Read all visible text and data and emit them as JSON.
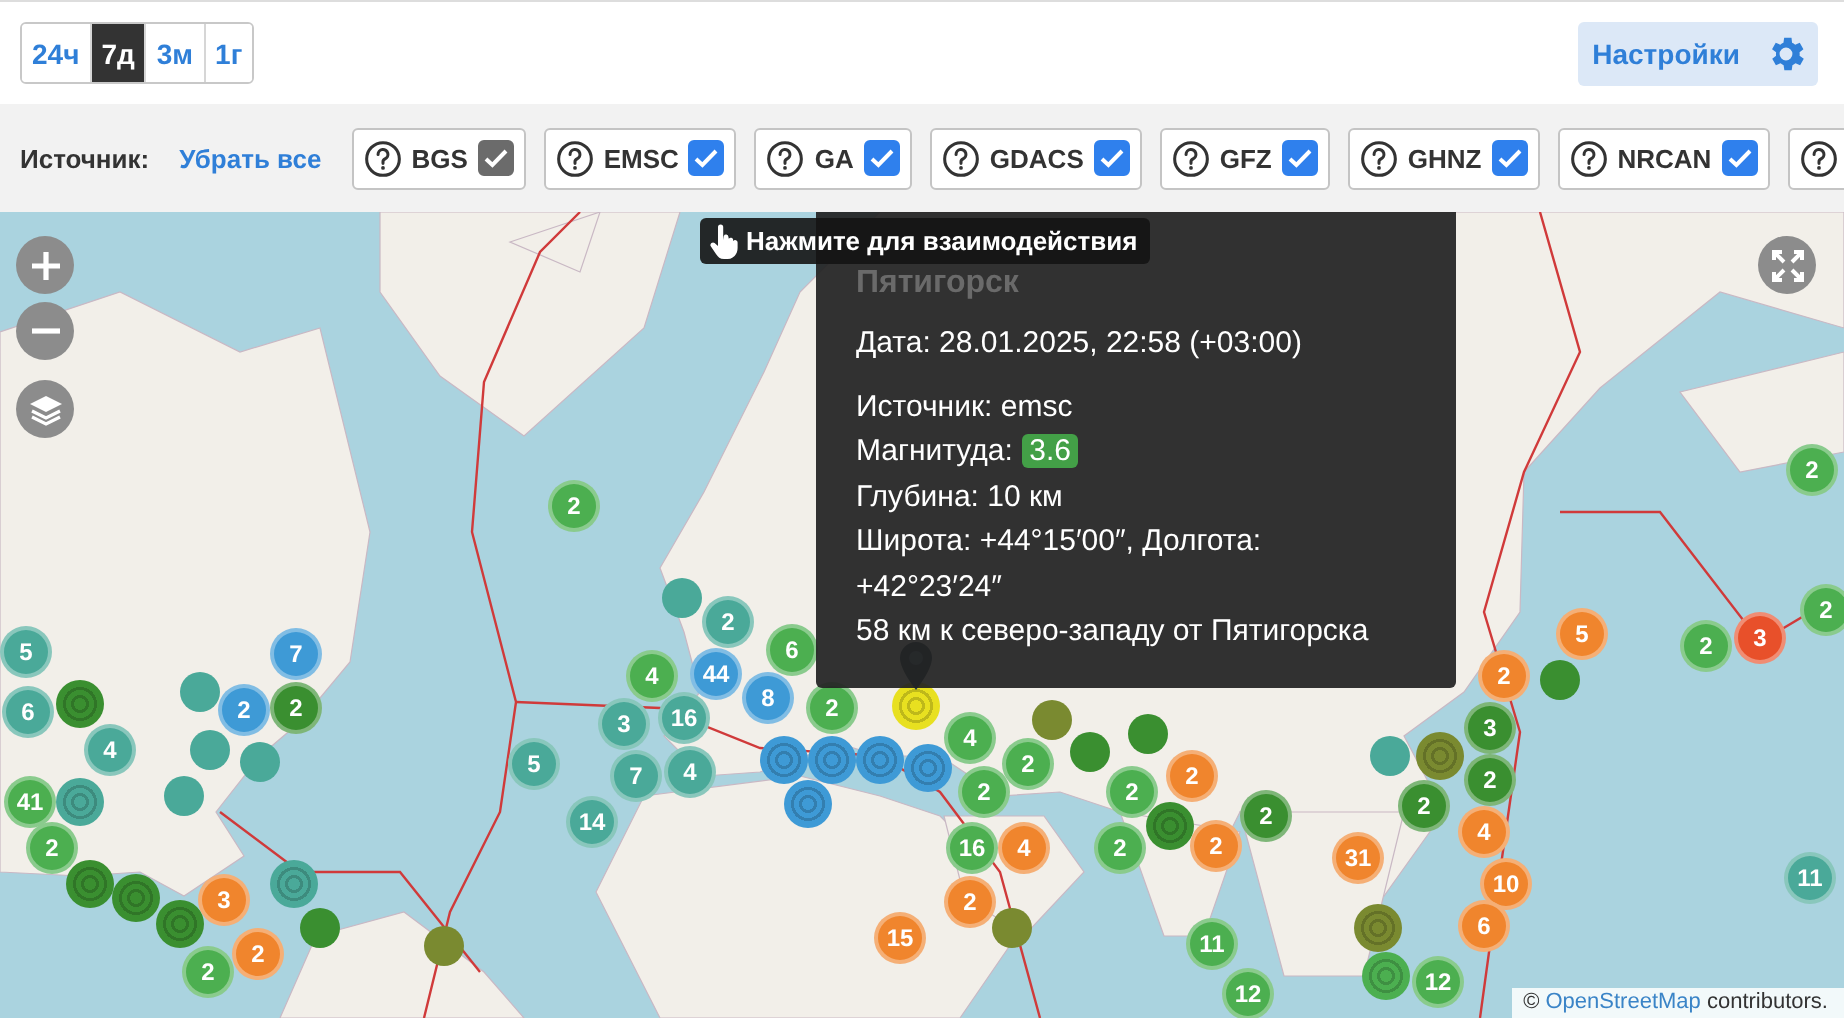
{
  "time_ranges": [
    {
      "label": "24ч",
      "selected": false
    },
    {
      "label": "7д",
      "selected": true
    },
    {
      "label": "3м",
      "selected": false
    },
    {
      "label": "1г",
      "selected": false
    }
  ],
  "settings_button": {
    "label": "Настройки"
  },
  "source_filter": {
    "label": "Источник:",
    "clear_link": "Убрать все",
    "sources": [
      {
        "label": "BGS",
        "checked": true,
        "disabled": true
      },
      {
        "label": "EMSC",
        "checked": true,
        "disabled": false
      },
      {
        "label": "GA",
        "checked": true,
        "disabled": false
      },
      {
        "label": "GDACS",
        "checked": true,
        "disabled": false
      },
      {
        "label": "GFZ",
        "checked": true,
        "disabled": false
      },
      {
        "label": "GHNZ",
        "checked": true,
        "disabled": false
      },
      {
        "label": "NRCAN",
        "checked": true,
        "disabled": false
      }
    ]
  },
  "map": {
    "markers": [
      {
        "kind": "cluster",
        "label": "2",
        "color": "#4caf50"
      },
      {
        "kind": "dot",
        "color": "#4aa999"
      },
      {
        "kind": "cluster",
        "label": "2",
        "color": "#4aa999"
      },
      {
        "kind": "cluster",
        "label": "6",
        "color": "#4caf50"
      },
      {
        "kind": "cluster",
        "label": "4",
        "color": "#4caf50"
      },
      {
        "kind": "cluster",
        "label": "16",
        "color": "#4aa999"
      },
      {
        "kind": "cluster",
        "label": "44",
        "color": "#3e9ad6"
      },
      {
        "kind": "cluster",
        "label": "8",
        "color": "#3e9ad6"
      },
      {
        "kind": "cluster",
        "label": "3",
        "color": "#4aa999"
      },
      {
        "kind": "cluster",
        "label": "7",
        "color": "#4aa999"
      },
      {
        "kind": "cluster",
        "label": "4",
        "color": "#4aa999"
      },
      {
        "kind": "cluster",
        "label": "5",
        "color": "#4aa999"
      },
      {
        "kind": "cluster",
        "label": "14",
        "color": "#4aa999"
      },
      {
        "kind": "cluster",
        "label": "2",
        "color": "#4caf50"
      },
      {
        "kind": "cluster",
        "label": "5",
        "color": "#4aa999"
      },
      {
        "kind": "cluster",
        "label": "6",
        "color": "#4aa999"
      },
      {
        "kind": "ring",
        "color": "#3a8f30"
      },
      {
        "kind": "cluster",
        "label": "4",
        "color": "#4aa999"
      },
      {
        "kind": "cluster",
        "label": "7",
        "color": "#3e9ad6"
      },
      {
        "kind": "cluster",
        "label": "2",
        "color": "#3e9ad6"
      },
      {
        "kind": "cluster",
        "label": "2",
        "color": "#3a8f30"
      },
      {
        "kind": "dot",
        "color": "#4aa999"
      },
      {
        "kind": "dot",
        "color": "#4aa999"
      },
      {
        "kind": "dot",
        "color": "#4aa999"
      },
      {
        "kind": "dot",
        "color": "#4aa999"
      },
      {
        "kind": "cluster",
        "label": "41",
        "color": "#4caf50"
      },
      {
        "kind": "ring",
        "color": "#4aa999"
      },
      {
        "kind": "cluster",
        "label": "2",
        "color": "#4caf50"
      },
      {
        "kind": "ring",
        "color": "#3a8f30"
      },
      {
        "kind": "ring",
        "color": "#3a8f30"
      },
      {
        "kind": "ring",
        "color": "#3a8f30"
      },
      {
        "kind": "cluster",
        "label": "3",
        "color": "#f0852d"
      },
      {
        "kind": "cluster",
        "label": "2",
        "color": "#4caf50"
      },
      {
        "kind": "cluster",
        "label": "2",
        "color": "#f0852d"
      },
      {
        "kind": "ring",
        "color": "#4aa999"
      },
      {
        "kind": "dot",
        "color": "#3a8f30"
      },
      {
        "kind": "dot",
        "color": "#7a8a30"
      },
      {
        "kind": "cluster",
        "label": "15",
        "color": "#f0852d"
      },
      {
        "kind": "ring",
        "color": "#3e9ad6"
      },
      {
        "kind": "ring",
        "color": "#3e9ad6"
      },
      {
        "kind": "ring",
        "color": "#3e9ad6"
      },
      {
        "kind": "ring",
        "color": "#3e9ad6"
      },
      {
        "kind": "ring",
        "color": "#3e9ad6"
      },
      {
        "kind": "ring",
        "color": "#e8e020"
      },
      {
        "kind": "cluster",
        "label": "4",
        "color": "#4caf50"
      },
      {
        "kind": "cluster",
        "label": "2",
        "color": "#4caf50"
      },
      {
        "kind": "cluster",
        "label": "2",
        "color": "#4caf50"
      },
      {
        "kind": "dot",
        "color": "#7a8a30"
      },
      {
        "kind": "cluster",
        "label": "16",
        "color": "#4caf50"
      },
      {
        "kind": "cluster",
        "label": "4",
        "color": "#f0852d"
      },
      {
        "kind": "cluster",
        "label": "2",
        "color": "#f0852d"
      },
      {
        "kind": "dot",
        "color": "#7a8a30"
      },
      {
        "kind": "dot",
        "color": "#3a8f30"
      },
      {
        "kind": "cluster",
        "label": "2",
        "color": "#4caf50"
      },
      {
        "kind": "dot",
        "color": "#3a8f30"
      },
      {
        "kind": "cluster",
        "label": "2",
        "color": "#f0852d"
      },
      {
        "kind": "cluster",
        "label": "2",
        "color": "#4caf50"
      },
      {
        "kind": "ring",
        "color": "#3a8f30"
      },
      {
        "kind": "cluster",
        "label": "2",
        "color": "#f0852d"
      },
      {
        "kind": "cluster",
        "label": "2",
        "color": "#3a8f30"
      },
      {
        "kind": "dot",
        "color": "#4aa999"
      },
      {
        "kind": "cluster",
        "label": "2",
        "color": "#3a8f30"
      },
      {
        "kind": "ring",
        "color": "#7a8a30"
      },
      {
        "kind": "cluster",
        "label": "3",
        "color": "#3a8f30"
      },
      {
        "kind": "cluster",
        "label": "2",
        "color": "#3a8f30"
      },
      {
        "kind": "cluster",
        "label": "4",
        "color": "#f0852d"
      },
      {
        "kind": "cluster",
        "label": "2",
        "color": "#f0852d"
      },
      {
        "kind": "dot",
        "color": "#3a8f30"
      },
      {
        "kind": "cluster",
        "label": "5",
        "color": "#f0852d"
      },
      {
        "kind": "cluster",
        "label": "2",
        "color": "#4caf50"
      },
      {
        "kind": "cluster",
        "label": "3",
        "color": "#e8502a"
      },
      {
        "kind": "cluster",
        "label": "2",
        "color": "#4caf50"
      },
      {
        "kind": "cluster",
        "label": "2",
        "color": "#4caf50"
      },
      {
        "kind": "cluster",
        "label": "31",
        "color": "#f0852d"
      },
      {
        "kind": "cluster",
        "label": "10",
        "color": "#f0852d"
      },
      {
        "kind": "cluster",
        "label": "6",
        "color": "#f0852d"
      },
      {
        "kind": "cluster",
        "label": "11",
        "color": "#4aa999"
      },
      {
        "kind": "cluster",
        "label": "11",
        "color": "#4caf50"
      },
      {
        "kind": "cluster",
        "label": "12",
        "color": "#4caf50"
      },
      {
        "kind": "ring",
        "color": "#7a8a30"
      },
      {
        "kind": "ring",
        "color": "#4caf50"
      },
      {
        "kind": "cluster",
        "label": "12",
        "color": "#4caf50"
      }
    ],
    "popup": {
      "title": "Пятигорск",
      "lines": [
        {
          "kind": "date",
          "text": "Дата: 28.01.2025, 22:58 (+03:00)"
        },
        {
          "kind": "text",
          "text": "Источник: emsc"
        },
        {
          "kind": "magnitude",
          "text": "Магнитуда:",
          "value": "3.6"
        },
        {
          "kind": "text",
          "text": "Глубина: 10 км"
        },
        {
          "kind": "text",
          "text": "Широта: +44°15′00″, Долгота: +42°23′24″"
        },
        {
          "kind": "text",
          "text": "58 км к северо-западу от Пятигорска"
        }
      ]
    },
    "hint": "Нажмите для взаимодействия",
    "attribution": {
      "prefix": "©",
      "link": "OpenStreetMap",
      "suffix": "contributors."
    }
  }
}
